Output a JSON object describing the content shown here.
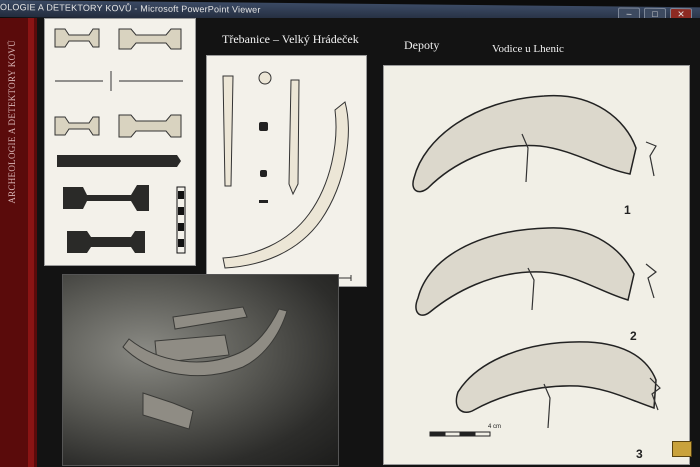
{
  "window": {
    "title": "OLOGIE A DETEKTORY KOVŮ - Microsoft PowerPoint Viewer",
    "buttons": {
      "minimize": "–",
      "maximize": "□",
      "close": "✕"
    }
  },
  "slide": {
    "sidebar_text": "ARCHEOLOGIE A DETEKTORY KOVŮ",
    "heading_site": "Třebanice – Velký Hrádeček",
    "heading_depoty": "Depoty",
    "heading_vodice": "Vodice u Lhenic",
    "figure_numbers": [
      "1",
      "2",
      "3"
    ],
    "scale_label": "4 cm",
    "icons": {
      "nav": "slide-nav-icon"
    }
  }
}
